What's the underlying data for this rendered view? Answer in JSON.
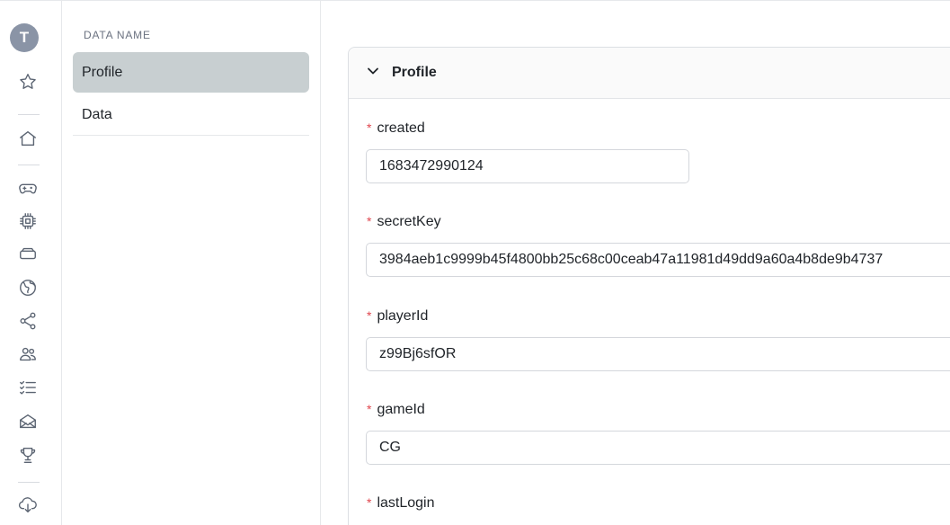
{
  "rail": {
    "avatar_letter": "T",
    "icons": [
      "star-icon",
      "home-icon",
      "gamepad-icon",
      "chip-icon",
      "storage-icon",
      "globe-icon",
      "share-icon",
      "users-icon",
      "checklist-icon",
      "mail-icon",
      "trophy-icon",
      "cloud-download-icon"
    ]
  },
  "namecol": {
    "title": "DATA NAME",
    "items": [
      {
        "label": "Profile",
        "active": true
      },
      {
        "label": "Data",
        "active": false
      }
    ]
  },
  "panel": {
    "title": "Profile",
    "fields": [
      {
        "label": "created",
        "required": "*",
        "value": "1683472990124"
      },
      {
        "label": "secretKey",
        "required": "*",
        "value": "3984aeb1c9999b45f4800bb25c68c00ceab47a11981d49dd9a60a4b8de9b4737"
      },
      {
        "label": "playerId",
        "required": "*",
        "value": "z99Bj6sfOR"
      },
      {
        "label": "gameId",
        "required": "*",
        "value": "CG"
      },
      {
        "label": "lastLogin",
        "required": "*",
        "value": ""
      }
    ]
  },
  "colors": {
    "active_item_bg": "#c8cfd1",
    "required_mark": "#e0464e",
    "border": "#dcdfe3"
  }
}
